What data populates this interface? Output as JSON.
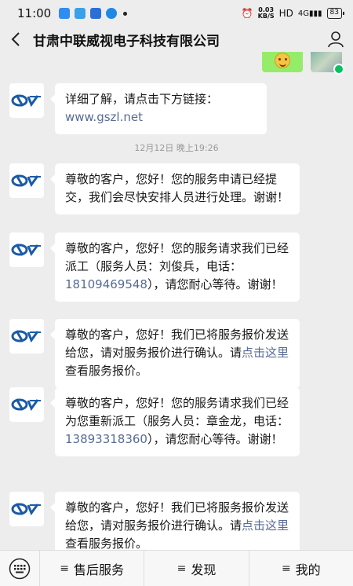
{
  "status_bar": {
    "time": "11:00",
    "net_speed_value": "0.03",
    "net_speed_unit": "KB/S",
    "hd": "HD",
    "signal": "4G",
    "battery": "83"
  },
  "header": {
    "title": "甘肃中联威视电子科技有限公司"
  },
  "messages": [
    {
      "text": "详细了解，请点击下方链接：",
      "link": "www.gszl.net"
    },
    {
      "text": "尊敬的客户，您好！您的服务申请已经提交，我们会尽快安排人员进行处理。谢谢！"
    },
    {
      "pre": "尊敬的客户，您好！您的服务请求我们已经派工（服务人员：刘俊兵，电话：",
      "phone": "18109469548",
      "post": "），请您耐心等待。谢谢！"
    },
    {
      "pre": "尊敬的客户，您好！我们已将服务报价发送给您，请对服务报价进行确认。请",
      "link": "点击这里",
      "post": "查看服务报价。"
    },
    {
      "pre": "尊敬的客户，您好！您的服务请求我们已经为您重新派工（服务人员：章金龙，电话：",
      "phone": "13893318360",
      "post": "），请您耐心等待。谢谢！"
    },
    {
      "pre": "尊敬的客户，您好！我们已将服务报价发送给您，请对服务报价进行确认。请",
      "link": "点击这里",
      "post": "查看服务报价。"
    }
  ],
  "timestamp": "12月12日 晚上19:26",
  "menu": {
    "item1": "售后服务",
    "item2": "发现",
    "item3": "我的",
    "menu_glyph": "≡"
  },
  "colors": {
    "link": "#576b95",
    "self_bubble": "#95ec69",
    "logo_blue": "#1a5aa8"
  }
}
